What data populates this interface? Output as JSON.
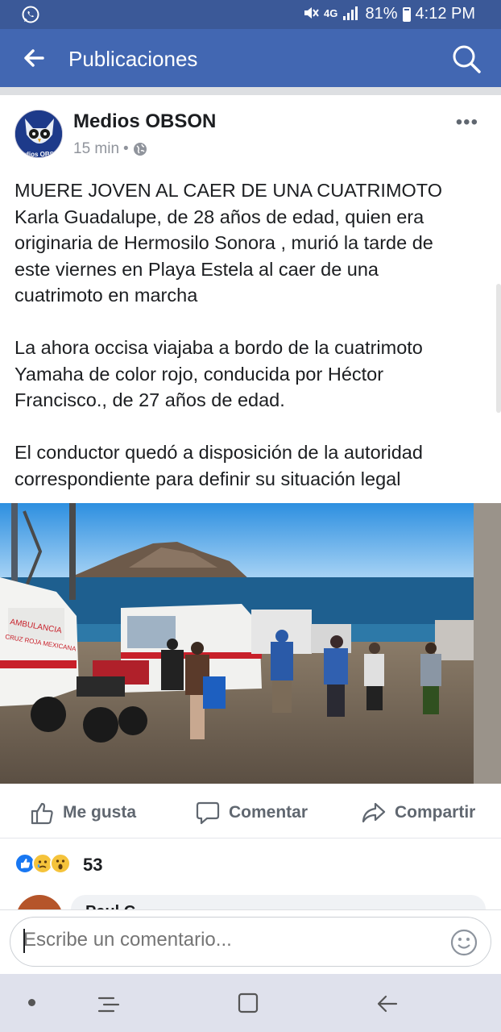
{
  "status_bar": {
    "network": "4G",
    "battery": "81%",
    "battery_level": 0.81,
    "time": "4:12 PM"
  },
  "app_bar": {
    "title": "Publicaciones",
    "back_icon": "arrow-left-icon",
    "search_icon": "search-icon"
  },
  "post": {
    "author": "Medios OBSON",
    "avatar_text": "dios OBS",
    "time": "15 min",
    "privacy_icon": "globe-icon",
    "paragraphs": [
      [
        "MUERE JOVEN AL CAER DE UNA CUATRIMOTO",
        "Karla Guadalupe, de 28 años de edad, quien era",
        "originaria de Hermosilo Sonora , murió la tarde de",
        "este viernes  en Playa Estela al caer de una",
        "cuatrimoto en marcha"
      ],
      [
        "La ahora occisa  viajaba  a bordo de la cuatrimoto",
        "Yamaha de color rojo, conducida por Héctor",
        "Francisco., de 27 años de edad."
      ],
      [
        "El conductor quedó a disposición de la autoridad",
        "correspondiente para definir su situación legal"
      ]
    ],
    "photo_texts": {
      "ambulance": "AMBULANCIA",
      "cruz": "CRUZ ROJA MEXICANA"
    }
  },
  "actions": {
    "like": "Me gusta",
    "comment": "Comentar",
    "share": "Compartir"
  },
  "reactions": {
    "types": [
      "like",
      "sad",
      "wow"
    ],
    "count": "53"
  },
  "comment_preview": {
    "name": "Paul C"
  },
  "composer": {
    "placeholder": "Escribe un comentario..."
  },
  "colors": {
    "statusbar": "#3b5998",
    "appbar": "#4267b2",
    "nav": "#dfe1ec"
  }
}
